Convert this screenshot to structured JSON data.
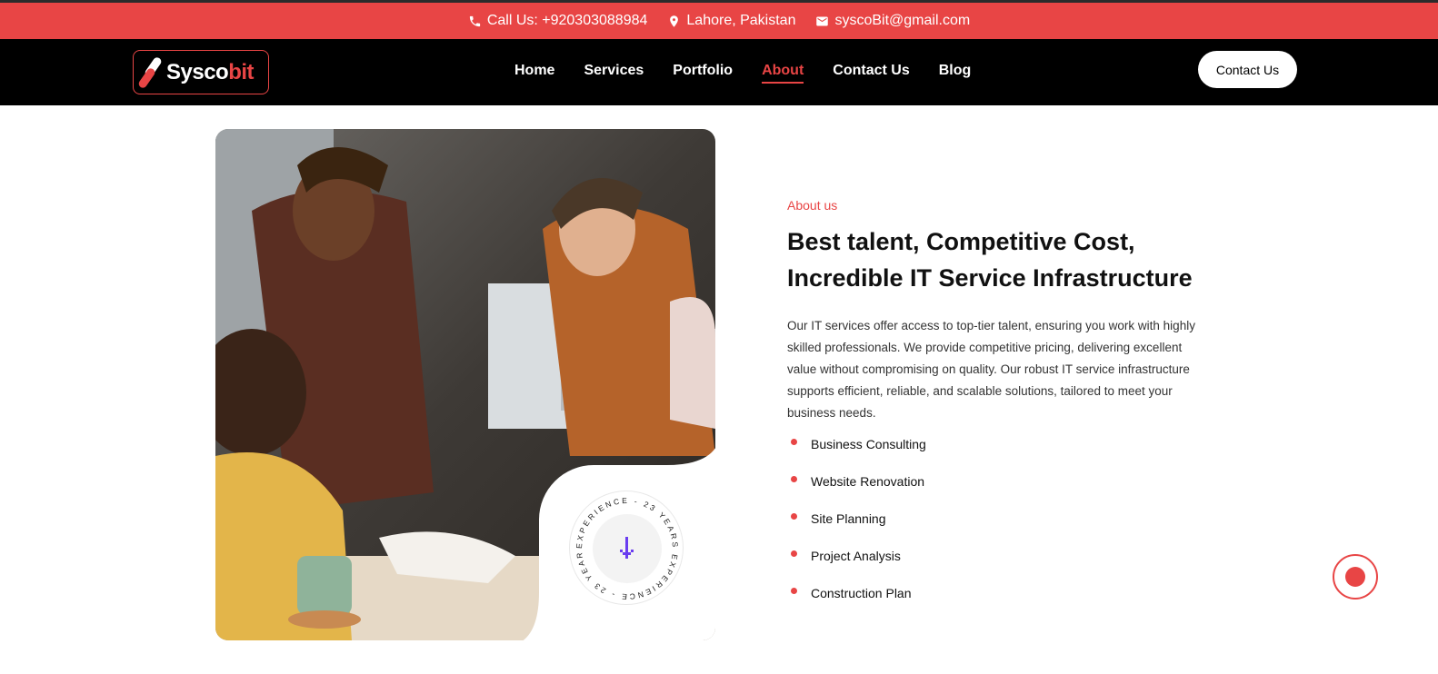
{
  "topbar": {
    "phone": "Call Us: +920303088984",
    "location": "Lahore, Pakistan",
    "email": "syscoBit@gmail.com"
  },
  "nav": {
    "logo_main": "Sysco",
    "logo_accent": "bit",
    "items": [
      {
        "label": "Home",
        "active": false
      },
      {
        "label": "Services",
        "active": false
      },
      {
        "label": "Portfolio",
        "active": false
      },
      {
        "label": "About",
        "active": true
      },
      {
        "label": "Contact Us",
        "active": false
      },
      {
        "label": "Blog",
        "active": false
      }
    ],
    "cta_label": "Contact Us"
  },
  "about": {
    "eyebrow": "About us",
    "heading_line1": "Best talent, Competitive Cost,",
    "heading_line2": "Incredible IT Service Infrastructure",
    "description": "Our IT services offer access to top-tier talent, ensuring you work with highly skilled professionals. We provide competitive pricing, delivering excellent value without compromising on quality. Our robust IT service infrastructure supports efficient, reliable, and scalable solutions, tailored to meet your business needs.",
    "features": [
      "Business Consulting",
      "Website Renovation",
      "Site Planning",
      "Project Analysis",
      "Construction Plan"
    ],
    "badge_text": "EXPERIENCE - 23 YEARS EXPERIENCE - 23 YEARS",
    "badge_icon": "arrow-down-icon"
  },
  "colors": {
    "accent": "#e84545",
    "nav_bg": "#000000",
    "badge_arrow": "#6a3df0"
  }
}
